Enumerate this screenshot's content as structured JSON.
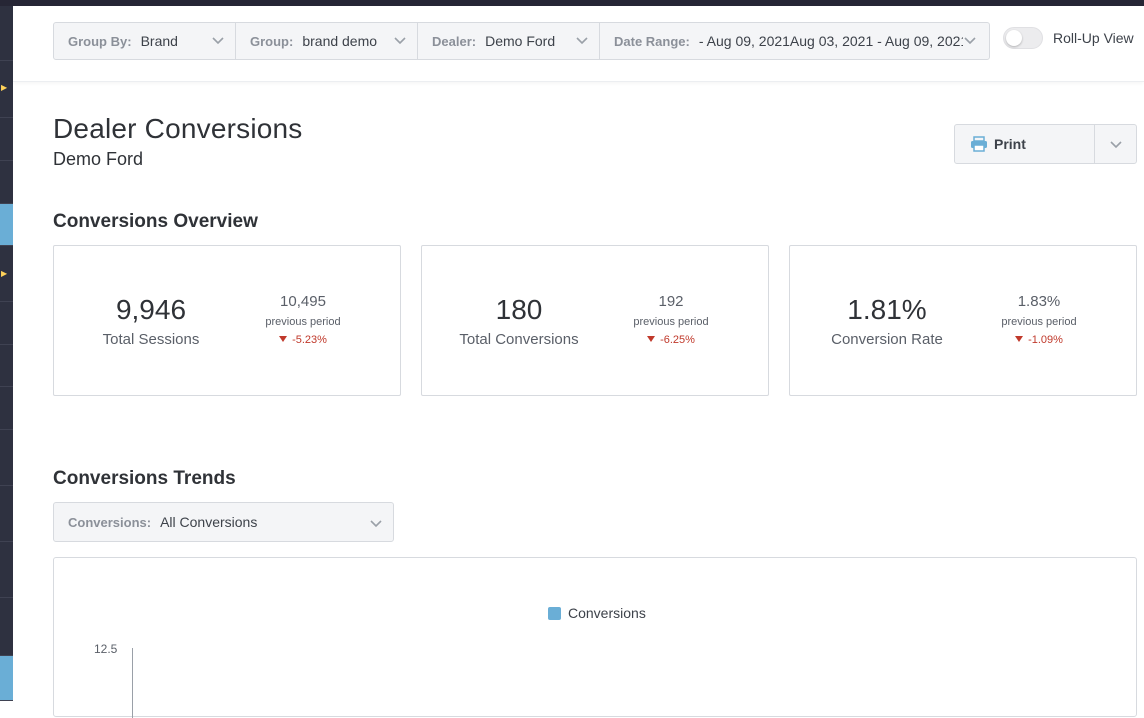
{
  "filters": {
    "group_by": {
      "label": "Group By:",
      "value": "Brand"
    },
    "group": {
      "label": "Group:",
      "value": "brand demo"
    },
    "dealer": {
      "label": "Dealer:",
      "value": "Demo Ford"
    },
    "date_range": {
      "label": "Date Range:",
      "value": "- Aug 09, 2021Aug 03, 2021 - Aug 09, 2021"
    }
  },
  "rollup": {
    "label": "Roll-Up View",
    "enabled": false
  },
  "page": {
    "title": "Dealer Conversions",
    "subtitle": "Demo Ford"
  },
  "print": {
    "label": "Print"
  },
  "overview": {
    "title": "Conversions Overview",
    "prev_label": "previous period",
    "cards": [
      {
        "value": "9,946",
        "label": "Total Sessions",
        "prev": "10,495",
        "delta": "-5.23%"
      },
      {
        "value": "180",
        "label": "Total Conversions",
        "prev": "192",
        "delta": "-6.25%"
      },
      {
        "value": "1.81%",
        "label": "Conversion Rate",
        "prev": "1.83%",
        "delta": "-1.09%"
      }
    ]
  },
  "trends": {
    "title": "Conversions Trends",
    "select": {
      "label": "Conversions:",
      "value": "All Conversions"
    }
  },
  "chart_data": {
    "type": "bar",
    "series": [
      {
        "name": "Conversions",
        "color": "#6aaed6"
      }
    ],
    "y_ticks": [
      "12.5"
    ],
    "legend_position": "top-center"
  },
  "colors": {
    "accent": "#6aaed6",
    "negative": "#c0392b",
    "sidebar": "#2b2d3a"
  }
}
